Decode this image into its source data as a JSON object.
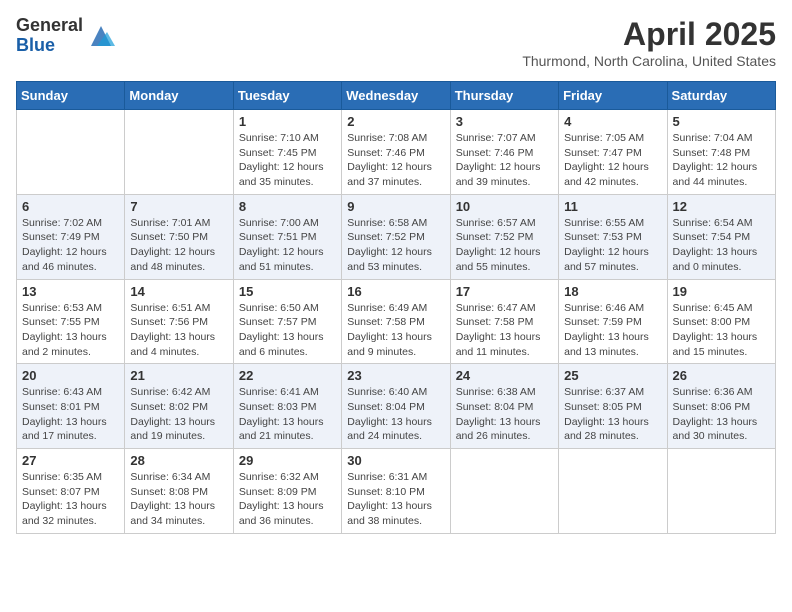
{
  "logo": {
    "general": "General",
    "blue": "Blue"
  },
  "title": "April 2025",
  "location": "Thurmond, North Carolina, United States",
  "weekdays": [
    "Sunday",
    "Monday",
    "Tuesday",
    "Wednesday",
    "Thursday",
    "Friday",
    "Saturday"
  ],
  "weeks": [
    [
      {
        "day": "",
        "info": ""
      },
      {
        "day": "",
        "info": ""
      },
      {
        "day": "1",
        "info": "Sunrise: 7:10 AM\nSunset: 7:45 PM\nDaylight: 12 hours and 35 minutes."
      },
      {
        "day": "2",
        "info": "Sunrise: 7:08 AM\nSunset: 7:46 PM\nDaylight: 12 hours and 37 minutes."
      },
      {
        "day": "3",
        "info": "Sunrise: 7:07 AM\nSunset: 7:46 PM\nDaylight: 12 hours and 39 minutes."
      },
      {
        "day": "4",
        "info": "Sunrise: 7:05 AM\nSunset: 7:47 PM\nDaylight: 12 hours and 42 minutes."
      },
      {
        "day": "5",
        "info": "Sunrise: 7:04 AM\nSunset: 7:48 PM\nDaylight: 12 hours and 44 minutes."
      }
    ],
    [
      {
        "day": "6",
        "info": "Sunrise: 7:02 AM\nSunset: 7:49 PM\nDaylight: 12 hours and 46 minutes."
      },
      {
        "day": "7",
        "info": "Sunrise: 7:01 AM\nSunset: 7:50 PM\nDaylight: 12 hours and 48 minutes."
      },
      {
        "day": "8",
        "info": "Sunrise: 7:00 AM\nSunset: 7:51 PM\nDaylight: 12 hours and 51 minutes."
      },
      {
        "day": "9",
        "info": "Sunrise: 6:58 AM\nSunset: 7:52 PM\nDaylight: 12 hours and 53 minutes."
      },
      {
        "day": "10",
        "info": "Sunrise: 6:57 AM\nSunset: 7:52 PM\nDaylight: 12 hours and 55 minutes."
      },
      {
        "day": "11",
        "info": "Sunrise: 6:55 AM\nSunset: 7:53 PM\nDaylight: 12 hours and 57 minutes."
      },
      {
        "day": "12",
        "info": "Sunrise: 6:54 AM\nSunset: 7:54 PM\nDaylight: 13 hours and 0 minutes."
      }
    ],
    [
      {
        "day": "13",
        "info": "Sunrise: 6:53 AM\nSunset: 7:55 PM\nDaylight: 13 hours and 2 minutes."
      },
      {
        "day": "14",
        "info": "Sunrise: 6:51 AM\nSunset: 7:56 PM\nDaylight: 13 hours and 4 minutes."
      },
      {
        "day": "15",
        "info": "Sunrise: 6:50 AM\nSunset: 7:57 PM\nDaylight: 13 hours and 6 minutes."
      },
      {
        "day": "16",
        "info": "Sunrise: 6:49 AM\nSunset: 7:58 PM\nDaylight: 13 hours and 9 minutes."
      },
      {
        "day": "17",
        "info": "Sunrise: 6:47 AM\nSunset: 7:58 PM\nDaylight: 13 hours and 11 minutes."
      },
      {
        "day": "18",
        "info": "Sunrise: 6:46 AM\nSunset: 7:59 PM\nDaylight: 13 hours and 13 minutes."
      },
      {
        "day": "19",
        "info": "Sunrise: 6:45 AM\nSunset: 8:00 PM\nDaylight: 13 hours and 15 minutes."
      }
    ],
    [
      {
        "day": "20",
        "info": "Sunrise: 6:43 AM\nSunset: 8:01 PM\nDaylight: 13 hours and 17 minutes."
      },
      {
        "day": "21",
        "info": "Sunrise: 6:42 AM\nSunset: 8:02 PM\nDaylight: 13 hours and 19 minutes."
      },
      {
        "day": "22",
        "info": "Sunrise: 6:41 AM\nSunset: 8:03 PM\nDaylight: 13 hours and 21 minutes."
      },
      {
        "day": "23",
        "info": "Sunrise: 6:40 AM\nSunset: 8:04 PM\nDaylight: 13 hours and 24 minutes."
      },
      {
        "day": "24",
        "info": "Sunrise: 6:38 AM\nSunset: 8:04 PM\nDaylight: 13 hours and 26 minutes."
      },
      {
        "day": "25",
        "info": "Sunrise: 6:37 AM\nSunset: 8:05 PM\nDaylight: 13 hours and 28 minutes."
      },
      {
        "day": "26",
        "info": "Sunrise: 6:36 AM\nSunset: 8:06 PM\nDaylight: 13 hours and 30 minutes."
      }
    ],
    [
      {
        "day": "27",
        "info": "Sunrise: 6:35 AM\nSunset: 8:07 PM\nDaylight: 13 hours and 32 minutes."
      },
      {
        "day": "28",
        "info": "Sunrise: 6:34 AM\nSunset: 8:08 PM\nDaylight: 13 hours and 34 minutes."
      },
      {
        "day": "29",
        "info": "Sunrise: 6:32 AM\nSunset: 8:09 PM\nDaylight: 13 hours and 36 minutes."
      },
      {
        "day": "30",
        "info": "Sunrise: 6:31 AM\nSunset: 8:10 PM\nDaylight: 13 hours and 38 minutes."
      },
      {
        "day": "",
        "info": ""
      },
      {
        "day": "",
        "info": ""
      },
      {
        "day": "",
        "info": ""
      }
    ]
  ]
}
